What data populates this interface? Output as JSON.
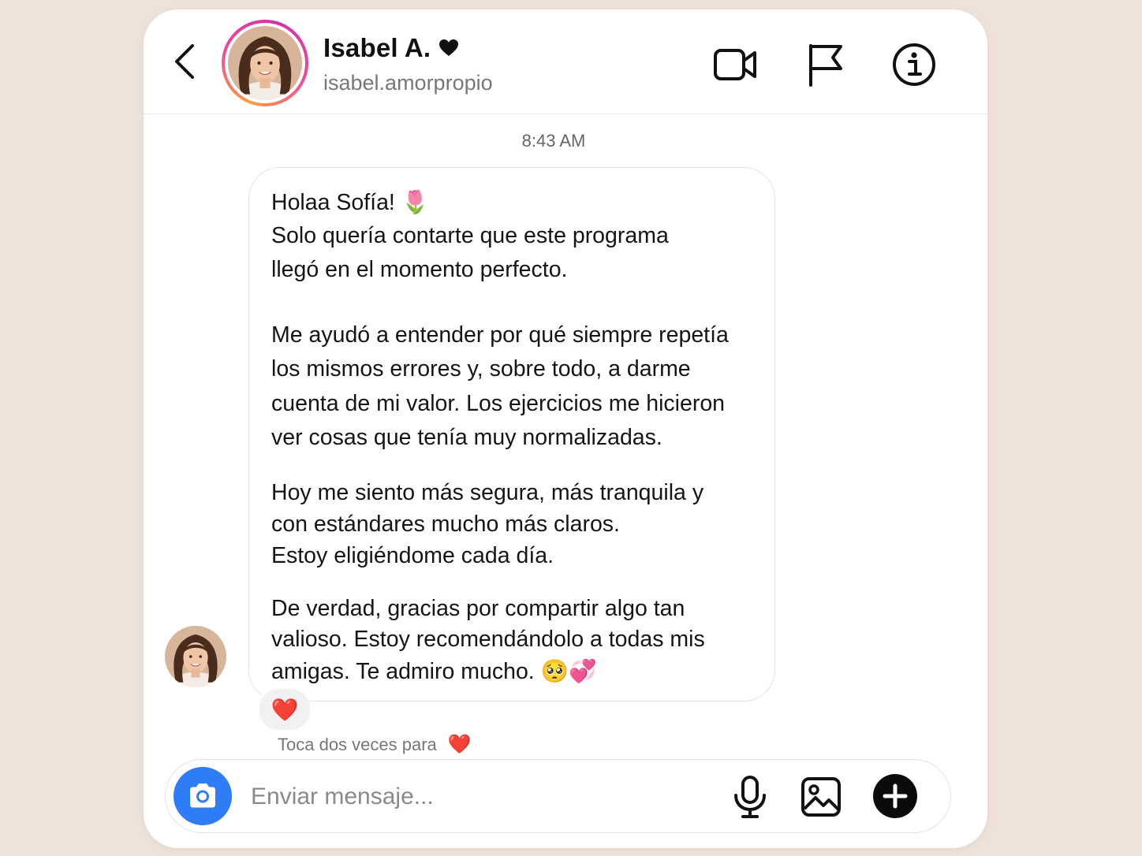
{
  "header": {
    "name": "Isabel A.",
    "handle": "isabel.amorpropio"
  },
  "thread": {
    "timestamp": "8:43 AM",
    "message_lines": [
      "Holaa Sofía! 🌷",
      "Solo quería contarte que este programa",
      "llegó en el momento perfecto.",
      "Me ayudó a entender por qué siempre repetía",
      "los mismos errores y, sobre todo, a darme",
      "cuenta de mi valor. Los ejercicios me hicieron",
      "ver cosas que tenía muy normalizadas.",
      "Hoy me siento más segura, más tranquila y",
      "con estándares mucho más claros.",
      "Estoy eligiéndome cada día.",
      "De verdad, gracias por compartir algo tan",
      "valioso. Estoy recomendándolo a todas mis",
      "amigas. Te admiro mucho. 🥺💞"
    ],
    "reaction": "❤️",
    "hint_text": "Toca dos veces para",
    "hint_emoji": "❤️"
  },
  "composer": {
    "placeholder": "Enviar mensaje..."
  },
  "colors": {
    "background": "#efe2d8",
    "camera_button": "#2f7df6",
    "story_ring": "#f0489b",
    "plus_button": "#0b0b0b"
  },
  "icons": {
    "back": "chevron-left-icon",
    "video": "video-camera-icon",
    "report": "flag-icon",
    "info": "info-icon",
    "camera": "camera-icon",
    "mic": "microphone-icon",
    "gallery": "image-icon",
    "add": "plus-icon"
  }
}
